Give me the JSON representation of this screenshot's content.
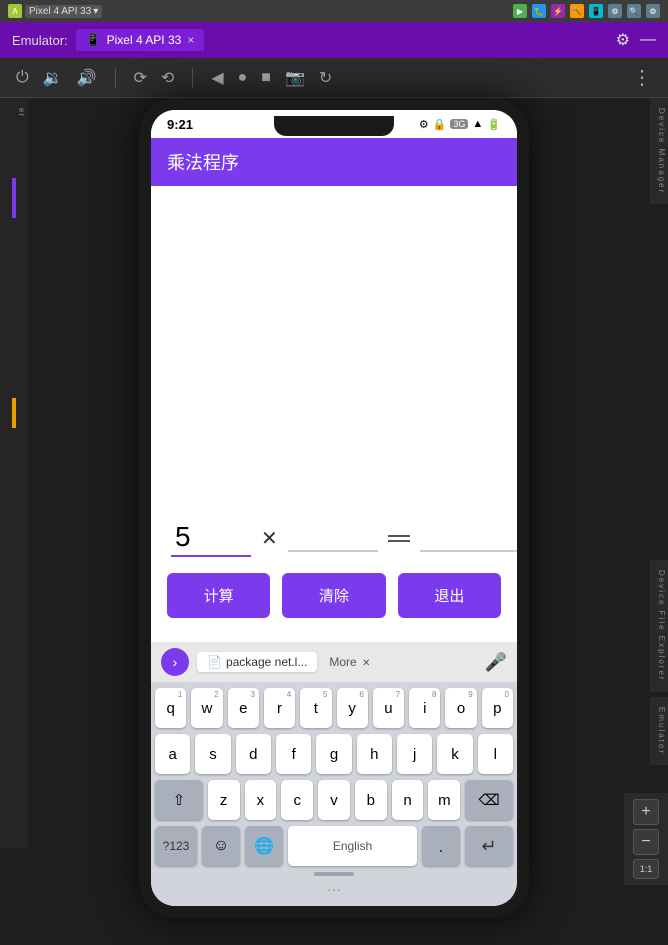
{
  "topbar": {
    "items": [
      {
        "label": "Pixel 4 API 33",
        "icon": "android-icon"
      },
      {
        "label": "▾"
      }
    ],
    "tools": [
      "run-icon",
      "debug-icon",
      "coverage-icon",
      "build-icon",
      "target-icon",
      "device-icon",
      "search-icon",
      "settings-icon"
    ]
  },
  "emulator_bar": {
    "label": "Emulator:",
    "tab": "Pixel 4 API 33",
    "close": "×"
  },
  "controls": {
    "icons": [
      "power-icon",
      "volume-down-icon",
      "volume-up-icon",
      "rotate-icon",
      "screenshot-icon",
      "back-icon",
      "home-icon",
      "square-icon",
      "camera-icon",
      "recents-icon",
      "more-icon"
    ]
  },
  "phone": {
    "status_bar": {
      "time": "9:21",
      "icons": "⚙ 🔒",
      "network": "3G",
      "signal": "📶",
      "battery": "🔋"
    },
    "app_bar": {
      "title": "乘法程序"
    },
    "inputs": {
      "first_value": "5",
      "second_value": "",
      "result_value": "",
      "first_placeholder": "",
      "second_placeholder": "",
      "result_placeholder": ""
    },
    "buttons": {
      "calc": "计算",
      "clear": "清除",
      "exit": "退出"
    },
    "keyboard": {
      "suggest_arrow": "›",
      "suggest_chip": "package net.l...",
      "suggest_more": "More",
      "rows": [
        [
          "q",
          "w",
          "e",
          "r",
          "t",
          "y",
          "u",
          "i",
          "o",
          "p"
        ],
        [
          "a",
          "s",
          "d",
          "f",
          "g",
          "h",
          "j",
          "k",
          "l"
        ],
        [
          "⇧",
          "z",
          "x",
          "c",
          "v",
          "b",
          "n",
          "m",
          "⌫"
        ],
        [
          "?123",
          "☺",
          "🌐",
          "English",
          ".",
          "↵"
        ]
      ],
      "row_numbers": [
        "1",
        "2",
        "3",
        "4",
        "5",
        "6",
        "7",
        "8",
        "9",
        "0"
      ],
      "lang": "English"
    }
  },
  "right_panel": {
    "top_label": "Device Manager",
    "bottom_label": "Device File Explorer",
    "emulator_label": "Emulator"
  },
  "zoom": {
    "plus": "+",
    "minus": "−",
    "ratio": "1:1"
  }
}
